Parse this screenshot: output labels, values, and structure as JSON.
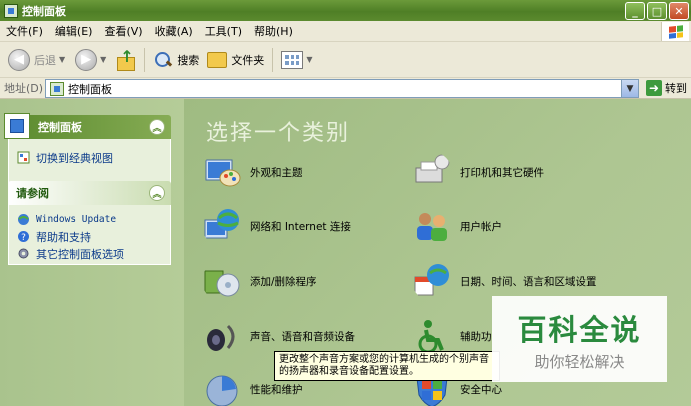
{
  "window": {
    "title": "控制面板",
    "buttons": {
      "minimize": "_",
      "maximize": "□",
      "close": "✕"
    }
  },
  "menubar": {
    "items": [
      "文件(F)",
      "编辑(E)",
      "查看(V)",
      "收藏(A)",
      "工具(T)",
      "帮助(H)"
    ]
  },
  "toolbar": {
    "back_label": "后退",
    "search_label": "搜索",
    "folders_label": "文件夹"
  },
  "addressbar": {
    "label": "地址(D)",
    "value": "控制面板",
    "go_label": "转到"
  },
  "sidebar": {
    "control_panel": {
      "title": "控制面板",
      "links": [
        {
          "label": "切换到经典视图"
        }
      ]
    },
    "see_also": {
      "title": "请参阅",
      "links": [
        {
          "label": "Windows Update"
        },
        {
          "label": "帮助和支持"
        },
        {
          "label": "其它控制面板选项"
        }
      ]
    }
  },
  "main": {
    "title": "选择一个类别",
    "categories": [
      {
        "label": "外观和主题"
      },
      {
        "label": "打印机和其它硬件"
      },
      {
        "label": "网络和 Internet 连接"
      },
      {
        "label": "用户帐户"
      },
      {
        "label": "添加/删除程序"
      },
      {
        "label": "日期、时间、语言和区域设置"
      },
      {
        "label": "声音、语音和音频设备"
      },
      {
        "label": "辅助功"
      },
      {
        "label": "性能和维护"
      },
      {
        "label": "安全中心"
      }
    ]
  },
  "tooltip": {
    "line1": "更改整个声音方案或您的计算机生成的个别声音",
    "line2": "的扬声器和录音设备配置设置。"
  },
  "watermark": {
    "main": "百科全说",
    "sub": "助你轻松解决"
  },
  "colors": {
    "xp_olive_title": "#5b8a2e",
    "main_bg": "#a8c28c",
    "link_blue": "#0b3a8a",
    "watermark_green": "#2a8a3e"
  }
}
